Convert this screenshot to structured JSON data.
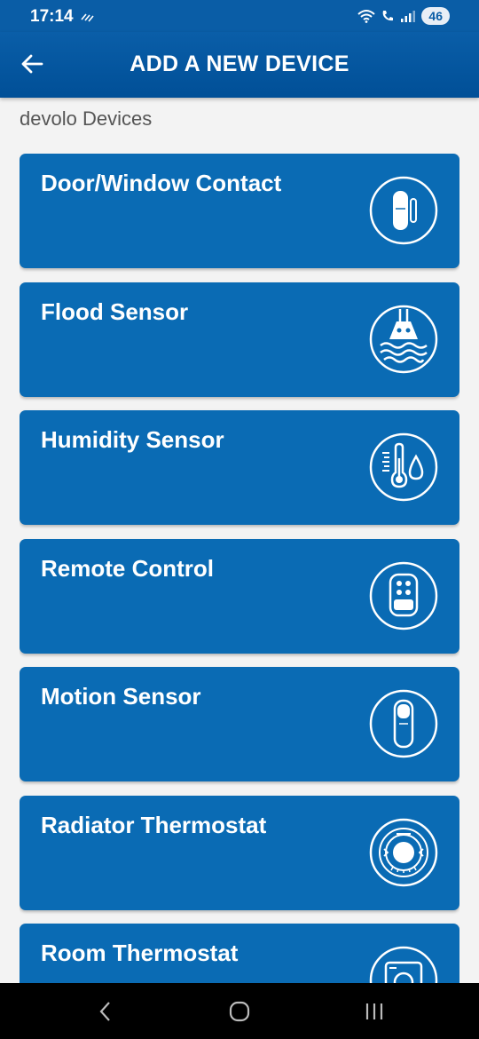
{
  "status": {
    "time": "17:14",
    "battery": "46"
  },
  "app_bar": {
    "title": "ADD A NEW DEVICE",
    "back_icon": "arrow-left-icon"
  },
  "section": {
    "label": "devolo Devices"
  },
  "devices": [
    {
      "name": "Door/Window Contact",
      "icon": "door-window-contact-icon"
    },
    {
      "name": "Flood Sensor",
      "icon": "flood-sensor-icon"
    },
    {
      "name": "Humidity Sensor",
      "icon": "humidity-sensor-icon"
    },
    {
      "name": "Remote Control",
      "icon": "remote-control-icon"
    },
    {
      "name": "Motion Sensor",
      "icon": "motion-sensor-icon"
    },
    {
      "name": "Radiator Thermostat",
      "icon": "radiator-thermostat-icon"
    },
    {
      "name": "Room Thermostat",
      "icon": "room-thermostat-icon"
    }
  ],
  "colors": {
    "app_bar": "#0a5da6",
    "card": "#0a6bb4",
    "background": "#f3f3f3"
  }
}
